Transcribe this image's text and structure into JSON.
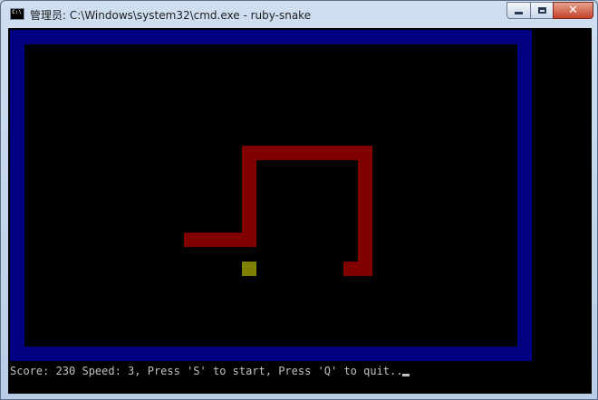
{
  "window": {
    "title": "管理员: C:\\Windows\\system32\\cmd.exe - ruby-snake",
    "icon_label": "C:\\",
    "close_glyph": "✕"
  },
  "status_line": "Score: 230 Speed: 3, Press 'S' to start, Press 'Q' to quit..",
  "colors": {
    "border": "#000080",
    "snake": "#800000",
    "food": "#808000",
    "background": "#000000",
    "text": "#c0c0c0"
  },
  "icons": [
    "cmd-icon",
    "minimize-icon",
    "maximize-icon",
    "close-icon"
  ]
}
